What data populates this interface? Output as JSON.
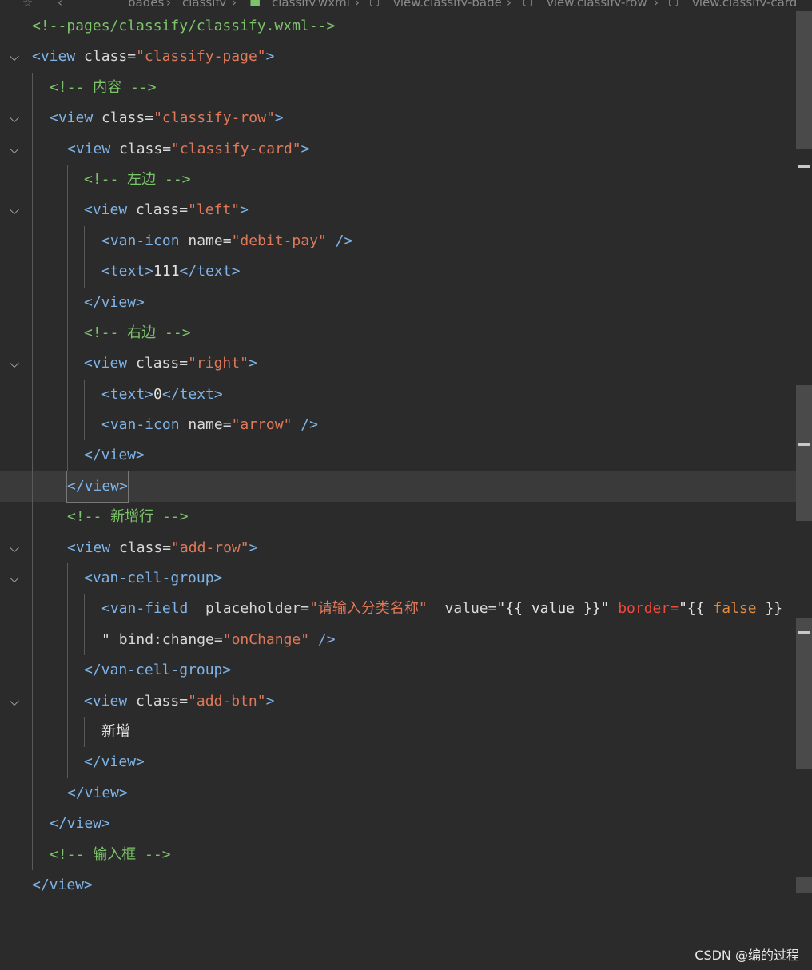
{
  "breadcrumb": {
    "items": [
      "pages",
      "classify",
      "classify.wxml",
      "view.classify-page",
      "view.classify-row",
      "view.classify-card"
    ]
  },
  "code": {
    "l1": "<!--pages/classify/classify.wxml-->",
    "l2_tag": "<view ",
    "l2_attr": "class=",
    "l2_str": "\"classify-page\"",
    "l2_end": ">",
    "l3": "<!-- 内容 -->",
    "l4_tag": "<view ",
    "l4_attr": "class=",
    "l4_str": "\"classify-row\"",
    "l4_end": ">",
    "l5_tag": "<view ",
    "l5_attr": "class=",
    "l5_str": "\"classify-card\"",
    "l5_end": ">",
    "l6": "<!-- 左边 -->",
    "l7_tag": "<view ",
    "l7_attr": "class=",
    "l7_str": "\"left\"",
    "l7_end": ">",
    "l8_tag": "<van-icon ",
    "l8_attr": "name=",
    "l8_str": "\"debit-pay\"",
    "l8_end": " />",
    "l9_open": "<text>",
    "l9_val": "111",
    "l9_close": "</text>",
    "l10": "</view>",
    "l11": "<!-- 右边 -->",
    "l12_tag": "<view ",
    "l12_attr": "class=",
    "l12_str": "\"right\"",
    "l12_end": ">",
    "l13_open": "<text>",
    "l13_val": "0",
    "l13_close": "</text>",
    "l14_tag": "<van-icon ",
    "l14_attr": "name=",
    "l14_str": "\"arrow\"",
    "l14_end": " />",
    "l15": "</view>",
    "l16": "</view>",
    "l17": "<!-- 新增行 -->",
    "l18_tag": "<view ",
    "l18_attr": "class=",
    "l18_str": "\"add-row\"",
    "l18_end": ">",
    "l19": "<van-cell-group>",
    "l20_tag": "<van-field  ",
    "l20_a1": "placeholder=",
    "l20_s1": "\"请输入分类名称\"",
    "l20_a2": "  value=",
    "l20_s2": "\"{{ value }}\" ",
    "l20_a3": "border=",
    "l20_s3a": "\"{{ ",
    "l20_s3b": "false",
    "l20_s3c": " }}",
    "l21_s": "\" ",
    "l21_a": "bind:change=",
    "l21_str": "\"onChange\"",
    "l21_end": " />",
    "l22": "</van-cell-group>",
    "l23_tag": "<view ",
    "l23_attr": "class=",
    "l23_str": "\"add-btn\"",
    "l23_end": ">",
    "l24": "新增",
    "l25": "</view>",
    "l26": "</view>",
    "l27": "</view>",
    "l28": "<!-- 输入框 -->",
    "l29": "</view>"
  },
  "icons": {
    "fold": "chevron-down-icon"
  },
  "watermark": "CSDN @编的过程"
}
